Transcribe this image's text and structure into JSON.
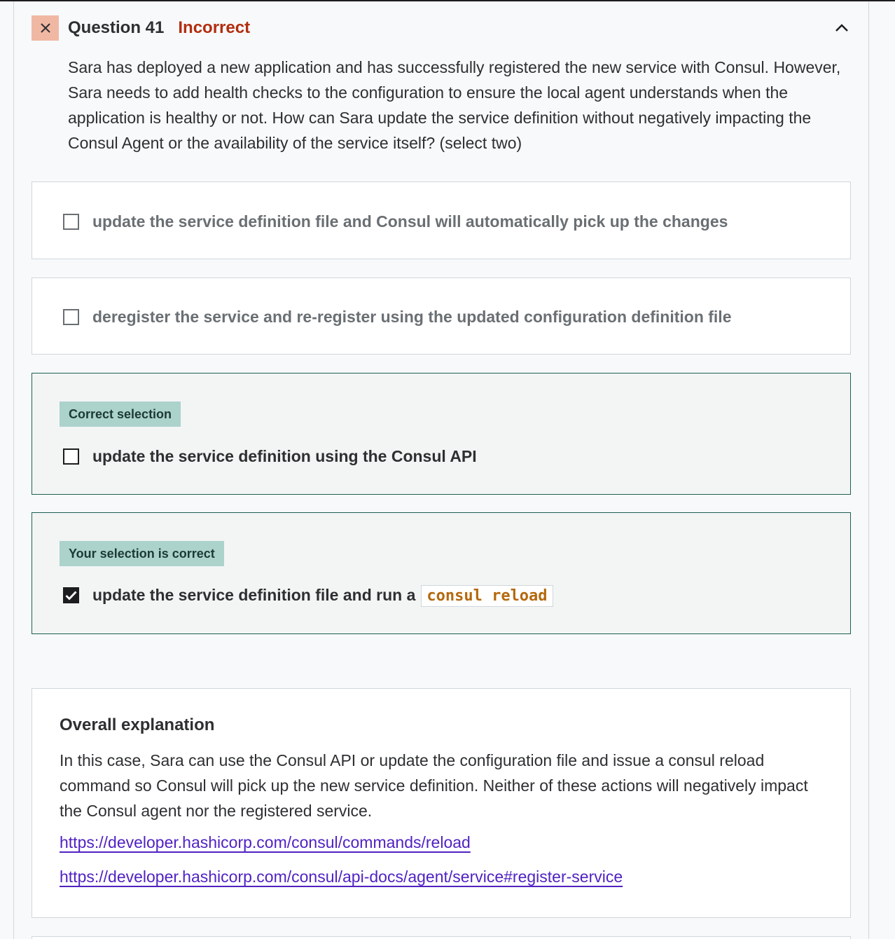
{
  "question": {
    "title": "Question 41",
    "status": "Incorrect",
    "text": "Sara has deployed a new application and has successfully registered the new service with Consul. However, Sara needs to add health checks to the configuration to ensure the local agent understands when the application is healthy or not. How can Sara update the service definition without negatively impacting the Consul Agent or the availability of the service itself? (select two)"
  },
  "answers": [
    {
      "label": "update the service definition file and Consul will automatically pick up the changes",
      "checked": false
    },
    {
      "label": "deregister the service and re-register using the updated configuration definition file",
      "checked": false
    },
    {
      "badge": "Correct selection",
      "label": "update the service definition using the Consul API",
      "checked": false
    },
    {
      "badge": "Your selection is correct",
      "label": "update the service definition file and run a",
      "code": "consul reload",
      "checked": true
    }
  ],
  "explanation": {
    "heading": "Overall explanation",
    "text": "In this case, Sara can use the Consul API or update the configuration file and issue a consul reload command so Consul will pick up the new service definition. Neither of these actions will negatively impact the Consul agent nor the registered service.",
    "links": [
      "https://developer.hashicorp.com/consul/commands/reload",
      "https://developer.hashicorp.com/consul/api-docs/agent/service#register-service"
    ]
  },
  "colors": {
    "incorrect": "#b32d0f",
    "correct_border": "#1e6055",
    "badge_bg": "#acd2cc",
    "link": "#5022c3",
    "code": "#b4690e"
  },
  "icons": {
    "status": "close-icon",
    "collapse": "chevron-up-icon",
    "checked": "checkmark-icon"
  }
}
